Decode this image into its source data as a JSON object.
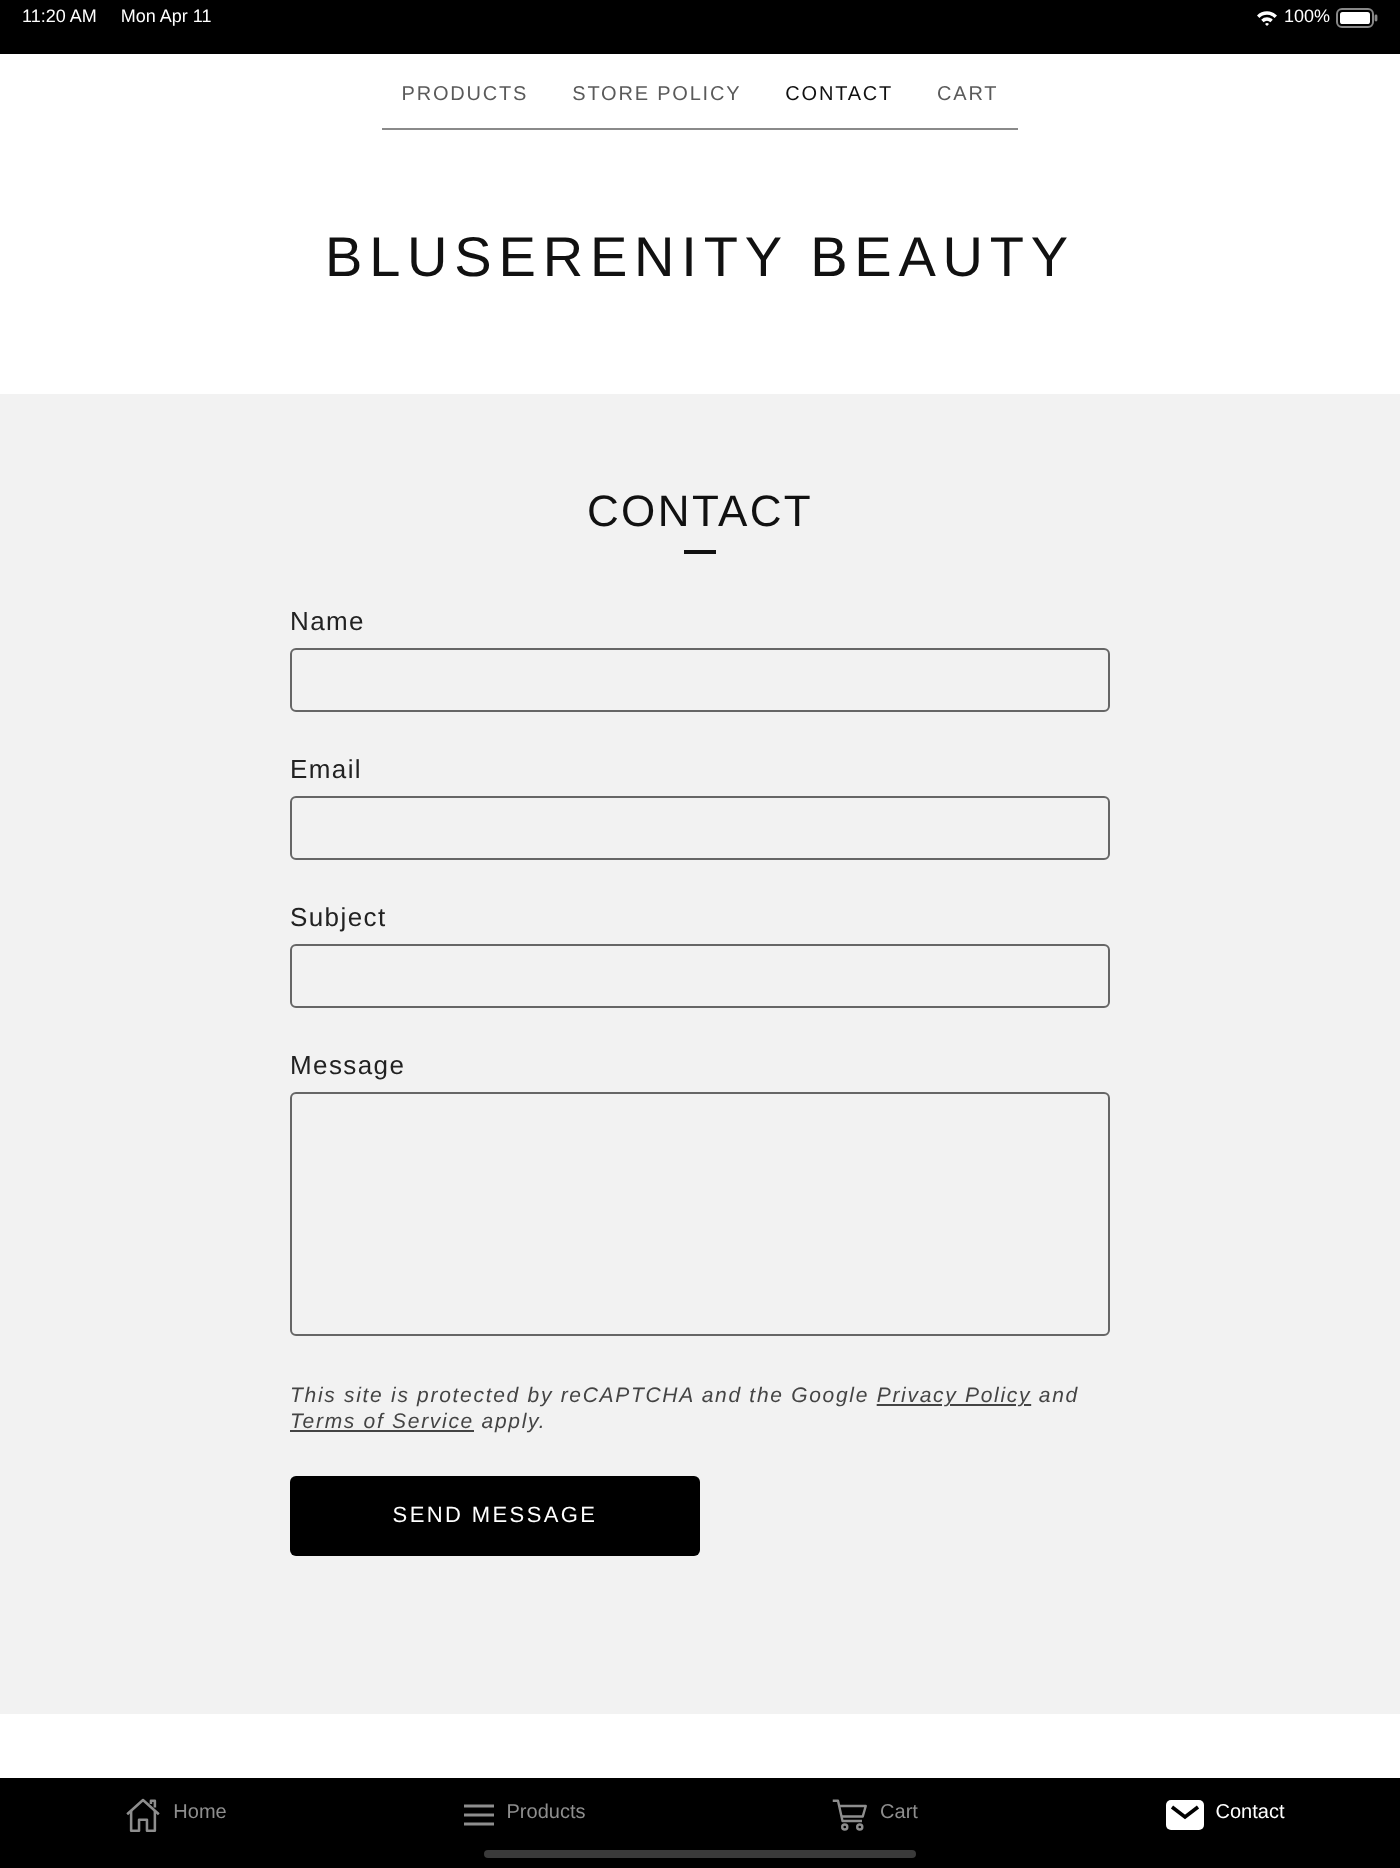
{
  "status_bar": {
    "time": "11:20 AM",
    "date": "Mon Apr 11",
    "battery": "100%"
  },
  "nav": {
    "items": [
      {
        "label": "PRODUCTS",
        "selected": false
      },
      {
        "label": "STORE POLICY",
        "selected": false
      },
      {
        "label": "CONTACT",
        "selected": true
      },
      {
        "label": "CART",
        "selected": false
      }
    ]
  },
  "site_title": "BLUSERENITY BEAUTY",
  "contact_form": {
    "heading": "CONTACT",
    "fields": [
      {
        "label": "Name",
        "kind": "input"
      },
      {
        "label": "Email",
        "kind": "input"
      },
      {
        "label": "Subject",
        "kind": "input"
      },
      {
        "label": "Message",
        "kind": "textarea"
      }
    ],
    "recaptcha_notice": [
      {
        "kind": "text",
        "text": "This site is protected by reCAPTCHA and the Google"
      },
      {
        "kind": "link",
        "text": "Privacy Policy"
      },
      {
        "kind": "text",
        "text": "and"
      },
      {
        "kind": "link",
        "text": "Terms of Service"
      },
      {
        "kind": "text",
        "text": "apply."
      }
    ],
    "submit_button": "SEND MESSAGE"
  },
  "tab_bar": {
    "tabs": [
      {
        "label": "Home",
        "selected": false
      },
      {
        "label": "Products",
        "selected": false
      },
      {
        "label": "Cart",
        "selected": false
      },
      {
        "label": "Contact",
        "selected": true
      }
    ]
  }
}
